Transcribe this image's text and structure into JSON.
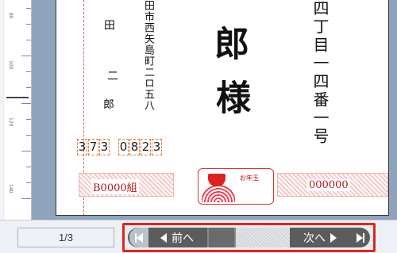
{
  "ruler": {
    "labels": [
      "80",
      "100",
      "120",
      "140"
    ]
  },
  "postcard": {
    "address_line1": "四丁目一四番一号",
    "address_line2": "田市西矢島町二ロ五八",
    "name_top": "田",
    "name_mid": "二",
    "name_bottom": "郎",
    "big_name": "郎",
    "honorific": "様",
    "postal_a": [
      "3",
      "7",
      "3"
    ],
    "postal_b": [
      "0",
      "8",
      "2",
      "3"
    ],
    "lottery_code": "B0000組",
    "lottery_number": "000000",
    "lottery_emblem_label": "お年玉",
    "lottery_emblem_badge": "宝"
  },
  "navigation": {
    "page_indicator": "1/3",
    "prev_label": "前へ",
    "next_label": "次へ"
  },
  "colors": {
    "highlight_frame": "#e0261f",
    "lottery_red": "#b11a1a",
    "preview_bg": "#8fa3bd"
  }
}
